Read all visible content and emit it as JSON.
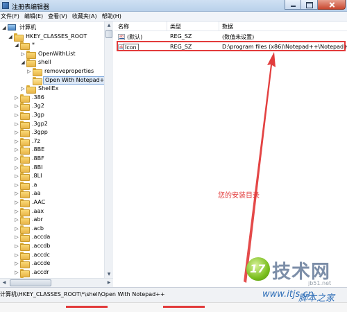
{
  "window": {
    "title": "注册表编辑器"
  },
  "menu": [
    "文件(F)",
    "编辑(E)",
    "查看(V)",
    "收藏夹(A)",
    "帮助(H)"
  ],
  "tree": {
    "items": [
      {
        "label": "计算机",
        "level": 0,
        "icon": "computer-icon",
        "expander": "▲"
      },
      {
        "label": "HKEY_CLASSES_ROOT",
        "level": 1,
        "icon": "folder-icon",
        "expander": "▲"
      },
      {
        "label": "*",
        "level": 2,
        "icon": "folder-icon",
        "expander": "▲"
      },
      {
        "label": "OpenWithList",
        "level": 3,
        "icon": "folder-icon",
        "expander": "▷"
      },
      {
        "label": "shell",
        "level": 3,
        "icon": "folder-icon",
        "expander": "▲"
      },
      {
        "label": "removeproperties",
        "level": 4,
        "icon": "folder-icon",
        "expander": "▷"
      },
      {
        "label": "Open With Notepad++",
        "level": 4,
        "icon": "folder-open-icon",
        "expander": "",
        "selected": true
      },
      {
        "label": "ShellEx",
        "level": 3,
        "icon": "folder-icon",
        "expander": "▷"
      },
      {
        "label": ".386",
        "level": 2,
        "icon": "folder-icon",
        "expander": "▷"
      },
      {
        "label": ".3g2",
        "level": 2,
        "icon": "folder-icon",
        "expander": "▷"
      },
      {
        "label": ".3gp",
        "level": 2,
        "icon": "folder-icon",
        "expander": "▷"
      },
      {
        "label": ".3gp2",
        "level": 2,
        "icon": "folder-icon",
        "expander": "▷"
      },
      {
        "label": ".3gpp",
        "level": 2,
        "icon": "folder-icon",
        "expander": "▷"
      },
      {
        "label": ".7z",
        "level": 2,
        "icon": "folder-icon",
        "expander": "▷"
      },
      {
        "label": ".8BE",
        "level": 2,
        "icon": "folder-icon",
        "expander": "▷"
      },
      {
        "label": ".8BF",
        "level": 2,
        "icon": "folder-icon",
        "expander": "▷"
      },
      {
        "label": ".8BI",
        "level": 2,
        "icon": "folder-icon",
        "expander": "▷"
      },
      {
        "label": ".8LI",
        "level": 2,
        "icon": "folder-icon",
        "expander": "▷"
      },
      {
        "label": ".a",
        "level": 2,
        "icon": "folder-icon",
        "expander": "▷"
      },
      {
        "label": ".aa",
        "level": 2,
        "icon": "folder-icon",
        "expander": "▷"
      },
      {
        "label": ".AAC",
        "level": 2,
        "icon": "folder-icon",
        "expander": "▷"
      },
      {
        "label": ".aax",
        "level": 2,
        "icon": "folder-icon",
        "expander": "▷"
      },
      {
        "label": ".abr",
        "level": 2,
        "icon": "folder-icon",
        "expander": "▷"
      },
      {
        "label": ".acb",
        "level": 2,
        "icon": "folder-icon",
        "expander": "▷"
      },
      {
        "label": ".accda",
        "level": 2,
        "icon": "folder-icon",
        "expander": "▷"
      },
      {
        "label": ".accdb",
        "level": 2,
        "icon": "folder-icon",
        "expander": "▷"
      },
      {
        "label": ".accdc",
        "level": 2,
        "icon": "folder-icon",
        "expander": "▷"
      },
      {
        "label": ".accde",
        "level": 2,
        "icon": "folder-icon",
        "expander": "▷"
      },
      {
        "label": ".accdr",
        "level": 2,
        "icon": "folder-icon",
        "expander": "▷"
      },
      {
        "label": ".accdt",
        "level": 2,
        "icon": "folder-icon",
        "expander": "▷"
      }
    ]
  },
  "values": {
    "headers": {
      "name": "名称",
      "type": "类型",
      "data": "数据"
    },
    "rows": [
      {
        "name": "(默认)",
        "type": "REG_SZ",
        "data": "(数值未设置)",
        "icon": "string-value-icon"
      },
      {
        "name": "Icon",
        "type": "REG_SZ",
        "data": "D:\\program files (x86)\\Notepad++\\Notepad++",
        "icon": "string-value-icon",
        "editing": true
      }
    ]
  },
  "annotation": {
    "text": "您的安装目录",
    "color": "#e23b3b"
  },
  "statusbar": {
    "path": "计算机\\HKEY_CLASSES_ROOT\\*\\shell\\Open With Notepad++"
  },
  "watermark": {
    "logo": "17",
    "big": "技术网",
    "url": "jb51.net",
    "site": "www.itjs.cn",
    "site2": "脚本之家"
  }
}
